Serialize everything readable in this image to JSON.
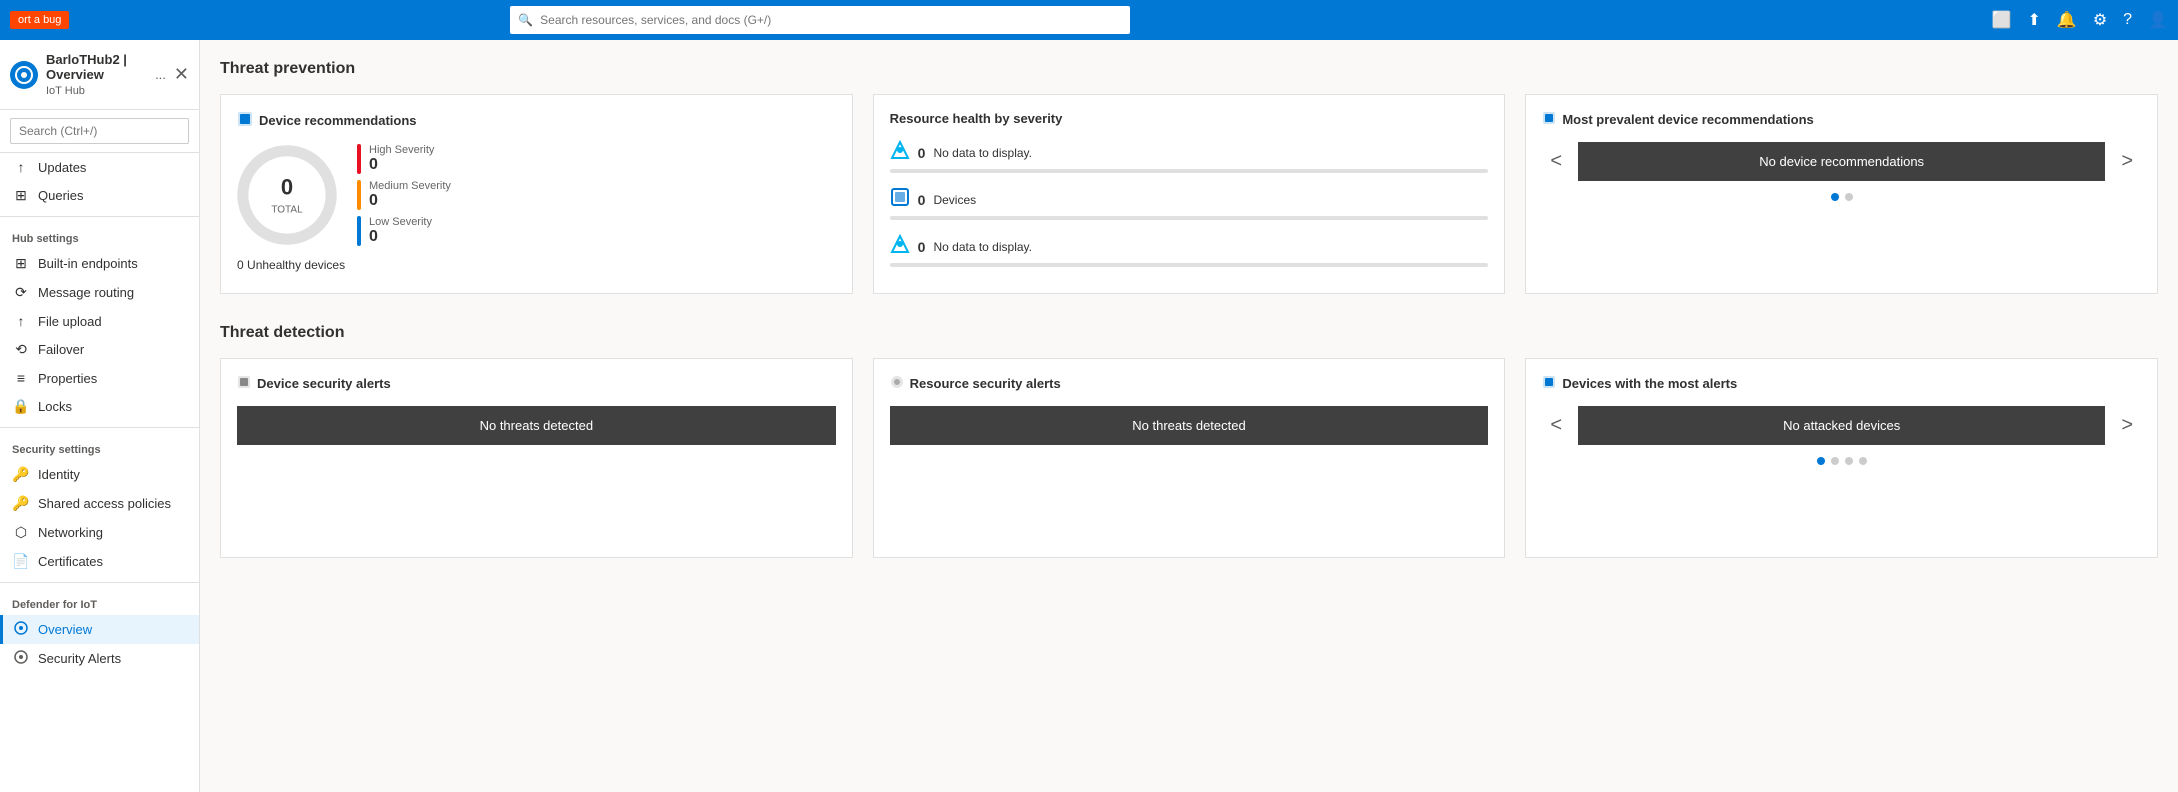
{
  "topbar": {
    "bug_label": "ort a bug",
    "search_placeholder": "Search resources, services, and docs (G+/)",
    "icons": [
      "screen-icon",
      "upload-icon",
      "bell-icon",
      "gear-icon",
      "help-icon",
      "feedback-icon"
    ]
  },
  "sidebar": {
    "hub_title": "BarloTHub2 | Overview",
    "hub_subtitle": "IoT Hub",
    "more_label": "...",
    "search_placeholder": "Search (Ctrl+/)",
    "items_above": [
      {
        "id": "updates",
        "label": "Updates",
        "icon": "↑"
      },
      {
        "id": "queries",
        "label": "Queries",
        "icon": "⊞"
      }
    ],
    "hub_settings_label": "Hub settings",
    "hub_settings_items": [
      {
        "id": "built-in-endpoints",
        "label": "Built-in endpoints",
        "icon": "⊞"
      },
      {
        "id": "message-routing",
        "label": "Message routing",
        "icon": "⟳"
      },
      {
        "id": "file-upload",
        "label": "File upload",
        "icon": "↑"
      },
      {
        "id": "failover",
        "label": "Failover",
        "icon": "⟲"
      },
      {
        "id": "properties",
        "label": "Properties",
        "icon": "≡"
      },
      {
        "id": "locks",
        "label": "Locks",
        "icon": "🔒"
      }
    ],
    "security_settings_label": "Security settings",
    "security_settings_items": [
      {
        "id": "identity",
        "label": "Identity",
        "icon": "🔑"
      },
      {
        "id": "shared-access-policies",
        "label": "Shared access policies",
        "icon": "🔑"
      },
      {
        "id": "networking",
        "label": "Networking",
        "icon": "⬡"
      },
      {
        "id": "certificates",
        "label": "Certificates",
        "icon": "📄"
      }
    ],
    "defender_label": "Defender for IoT",
    "defender_items": [
      {
        "id": "overview",
        "label": "Overview",
        "icon": "⊙",
        "active": true
      },
      {
        "id": "security-alerts",
        "label": "Security Alerts",
        "icon": "⊙"
      }
    ]
  },
  "main": {
    "threat_prevention": {
      "title": "Threat prevention",
      "device_recs": {
        "title": "Device recommendations",
        "total": 0,
        "total_label": "TOTAL",
        "high_severity_label": "High Severity",
        "high_value": 0,
        "medium_severity_label": "Medium Severity",
        "medium_value": 0,
        "low_severity_label": "Low Severity",
        "low_value": 0,
        "unhealthy_prefix": "0",
        "unhealthy_label": "Unhealthy devices"
      },
      "resource_health": {
        "title": "Resource health by severity",
        "items": [
          {
            "id": "rh1",
            "count": 0,
            "label": "No data to display.",
            "icon": "🔷"
          },
          {
            "id": "rh2",
            "count": 0,
            "label": "Devices",
            "icon": "🔲"
          },
          {
            "id": "rh3",
            "count": 0,
            "label": "No data to display.",
            "icon": "🔷"
          }
        ]
      },
      "most_prevalent": {
        "title": "Most prevalent device recommendations",
        "btn_label": "No device recommendations",
        "prev_label": "<",
        "next_label": ">",
        "dots": [
          true,
          false
        ]
      }
    },
    "threat_detection": {
      "title": "Threat detection",
      "device_security_alerts": {
        "title": "Device security alerts",
        "btn_label": "No threats detected"
      },
      "resource_security_alerts": {
        "title": "Resource security alerts",
        "btn_label": "No threats detected"
      },
      "devices_most_alerts": {
        "title": "Devices with the most alerts",
        "btn_label": "No attacked devices",
        "prev_label": "<",
        "next_label": ">",
        "dots": [
          true,
          false,
          false,
          false
        ]
      }
    }
  }
}
